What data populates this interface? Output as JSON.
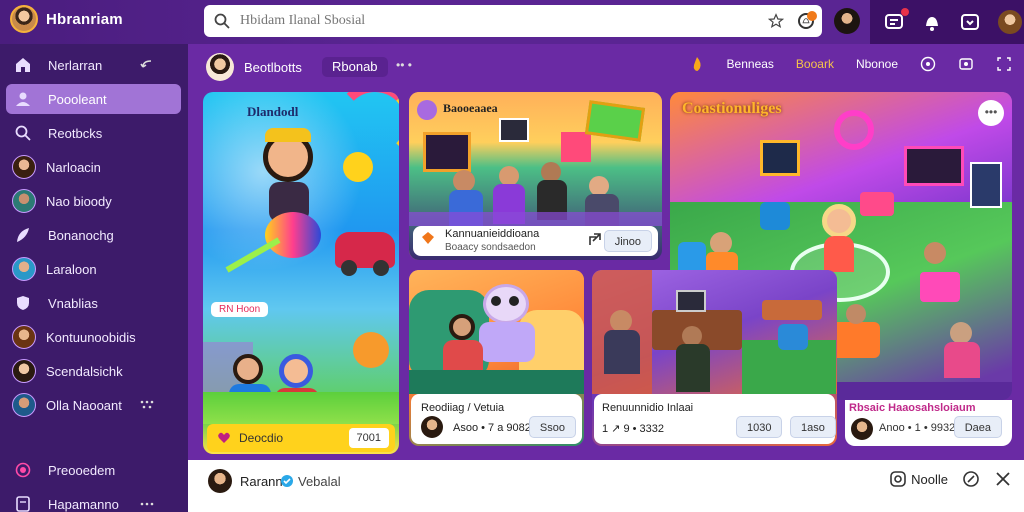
{
  "brand": {
    "name": "Hbranriam",
    "logo_icon": "avatar-logo"
  },
  "search": {
    "placeholder": "Hbidam Ilanal Sbosial"
  },
  "sidebar": {
    "items": [
      {
        "label": "Nerlarran",
        "icon": "home-icon"
      },
      {
        "label": "Poooleant",
        "icon": "people-icon",
        "active": true
      },
      {
        "label": "Reotbcks",
        "icon": "search-icon"
      },
      {
        "label": "Narloacin",
        "icon": "avatar"
      },
      {
        "label": "Nao bioody",
        "icon": "avatar"
      },
      {
        "label": "Bonanochg",
        "icon": "feather-icon"
      },
      {
        "label": "Laraloon",
        "icon": "avatar"
      },
      {
        "label": "Vnablias",
        "icon": "shield-icon"
      },
      {
        "label": "Kontuunoobidis",
        "icon": "avatar"
      },
      {
        "label": "Scendalsichk",
        "icon": "avatar"
      },
      {
        "label": "Olla Naooant",
        "icon": "avatar"
      },
      {
        "label": "Preooedem",
        "icon": "record-icon"
      },
      {
        "label": "Hapamanno",
        "icon": "doc-icon"
      }
    ]
  },
  "feed_header": {
    "name": "Beotlbotts",
    "chip": "Rbonab",
    "dots": "•• •",
    "tabs": [
      "Benneas",
      "Booark",
      "Nbonoe"
    ],
    "active_tab": "Booark"
  },
  "tiles": {
    "t1": {
      "title": "Dlandodl",
      "band": "RN Hoon",
      "foot": "Deocdio",
      "foot_pill": "7001"
    },
    "t2": {
      "title": "Baooeaaea",
      "card_text": "Kannuanieiddioana",
      "card_sub": "Boaacy sondsaedon",
      "pill": "Jinoo"
    },
    "t3": {
      "title": "Coastionuliges",
      "more": "•••"
    },
    "t4": {
      "title": "Reodiiag / Vetuia",
      "meta": "Asoo • 7 a 9082",
      "pill": "Ssoo"
    },
    "t5": {
      "title": "Renuunnidio Inlaai",
      "meta": "1 ↗ 9 • 3332",
      "pill1": "1030",
      "pill2": "1aso"
    },
    "t6": {
      "title": "Rbsaic Haaosahsloiaum",
      "meta": "Anoo • 1 • 9932",
      "pill": "Daea"
    }
  },
  "bottom_bar": {
    "name": "Rarann",
    "sub": "Vebalal",
    "action": "Noolle"
  },
  "colors": {
    "accent": "#6a2aa4",
    "sidebar": "#3d1b6a",
    "active": "#a174d6",
    "tab_active": "#f7c44a"
  }
}
